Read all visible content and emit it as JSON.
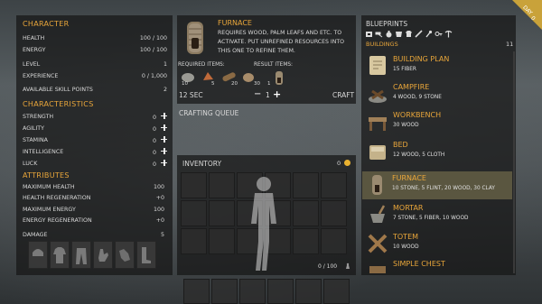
{
  "character": {
    "title": "CHARACTER",
    "stats": [
      {
        "label": "HEALTH",
        "value": "100 / 100"
      },
      {
        "label": "ENERGY",
        "value": "100 / 100"
      },
      {
        "label": "LEVEL",
        "value": "1"
      },
      {
        "label": "EXPERIENCE",
        "value": "0 / 1,000"
      },
      {
        "label": "AVAILABLE SKILL POINTS",
        "value": "2"
      }
    ]
  },
  "characteristics": {
    "title": "CHARACTERISTICS",
    "items": [
      {
        "label": "STRENGTH",
        "value": "0"
      },
      {
        "label": "AGILITY",
        "value": "0"
      },
      {
        "label": "STAMINA",
        "value": "0"
      },
      {
        "label": "INTELLIGENCE",
        "value": "0"
      },
      {
        "label": "LUCK",
        "value": "0"
      }
    ]
  },
  "attributes": {
    "title": "ATTRIBUTES",
    "items": [
      {
        "label": "MAXIMUM HEALTH",
        "value": "100"
      },
      {
        "label": "HEALTH REGENERATION",
        "value": "+0"
      },
      {
        "label": "MAXIMUM ENERGY",
        "value": "100"
      },
      {
        "label": "ENERGY REGENERATION",
        "value": "+0"
      }
    ],
    "damage": {
      "label": "DAMAGE",
      "value": "5"
    }
  },
  "furnace": {
    "title": "FURNACE",
    "description": "REQUIRES WOOD, PALM LEAFS AND ETC. TO ACTIVATE. PUT UNREFINED RESOURCES INTO THIS ONE TO REFINE THEM.",
    "required_label": "REQUIRED ITEMS:",
    "result_label": "RESULT ITEMS:",
    "required": [
      "10",
      "5",
      "20",
      "30"
    ],
    "result": "1",
    "time": "12 SEC",
    "quantity": "1",
    "minus": "−",
    "plus": "+",
    "craft": "CRAFT",
    "queue_title": "CRAFTING QUEUE"
  },
  "inventory": {
    "title": "INVENTORY",
    "coins": "0",
    "capacity": "0 / 100"
  },
  "blueprints": {
    "title": "BLUEPRINTS",
    "tab": "BUILDINGS",
    "count": "11",
    "items": [
      {
        "name": "BUILDING PLAN",
        "req": "15 FIBER"
      },
      {
        "name": "CAMPFIRE",
        "req": "4 WOOD, 9 STONE"
      },
      {
        "name": "WORKBENCH",
        "req": "30 WOOD"
      },
      {
        "name": "BED",
        "req": "12 WOOD, 5 CLOTH"
      },
      {
        "name": "FURNACE",
        "req": "10 STONE, 5 FLINT, 20 WOOD, 30 CLAY"
      },
      {
        "name": "MORTAR",
        "req": "7 STONE, 5 FIBER, 10 WOOD"
      },
      {
        "name": "TOTEM",
        "req": "10 WOOD"
      },
      {
        "name": "SIMPLE CHEST",
        "req": ""
      }
    ]
  },
  "day": {
    "label": "DAY",
    "value": "0"
  },
  "colors": {
    "accent": "#e9a63a",
    "selected": "#5a5640",
    "panel": "#161616"
  }
}
